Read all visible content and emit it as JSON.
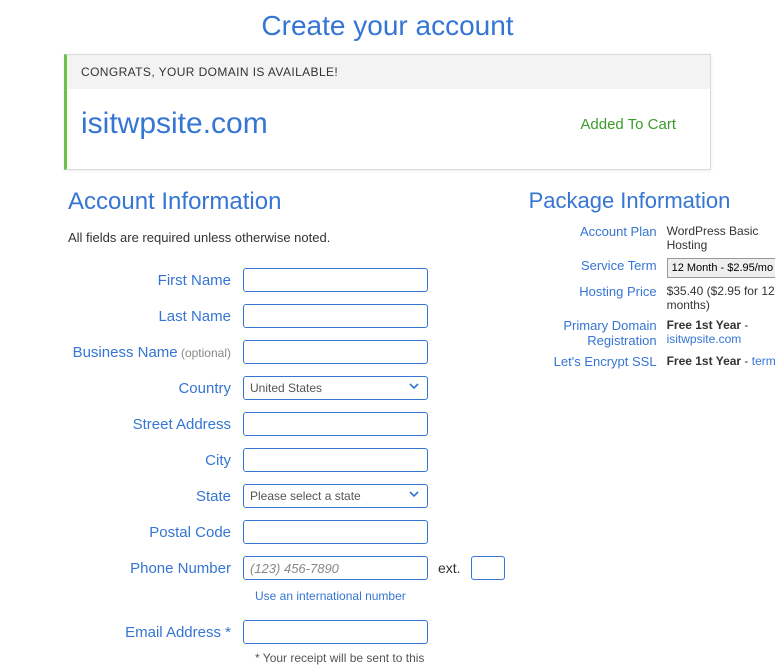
{
  "title": "Create your account",
  "domain": {
    "congrats": "CONGRATS, YOUR DOMAIN IS AVAILABLE!",
    "name": "isitwpsite.com",
    "added": "Added To Cart"
  },
  "account": {
    "heading": "Account Information",
    "required_note": "All fields are required unless otherwise noted.",
    "labels": {
      "first_name": "First Name",
      "last_name": "Last Name",
      "business_name": "Business Name",
      "business_optional": " (optional)",
      "country": "Country",
      "street": "Street Address",
      "city": "City",
      "state": "State",
      "postal": "Postal Code",
      "phone": "Phone Number",
      "ext": "ext.",
      "email": "Email Address *"
    },
    "values": {
      "country_selected": "United States",
      "state_placeholder": "Please select a state",
      "phone_placeholder": "(123) 456-7890"
    },
    "links": {
      "intl_phone": "Use an international number"
    },
    "notes": {
      "email_receipt": "* Your receipt will be sent to this"
    }
  },
  "package": {
    "heading": "Package Information",
    "labels": {
      "plan": "Account Plan",
      "term": "Service Term",
      "price": "Hosting Price",
      "domain": "Primary Domain Registration",
      "ssl": "Let's Encrypt SSL"
    },
    "values": {
      "plan": "WordPress Basic Hosting",
      "term_selected": "12 Month - $2.95/mo",
      "price": "$35.40 ($2.95 for 12 months)",
      "domain_prefix": "Free 1st Year",
      "domain_link": "isitwpsite.com",
      "ssl_prefix": "Free 1st Year",
      "ssl_link": "terms"
    }
  }
}
